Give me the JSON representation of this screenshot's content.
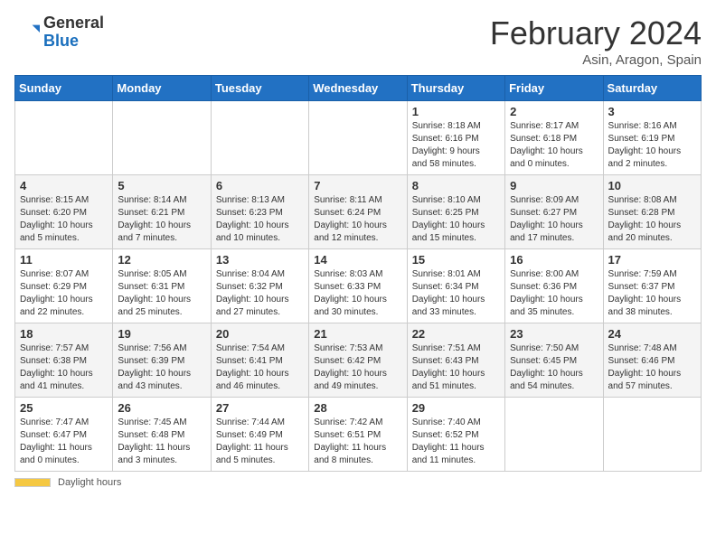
{
  "logo": {
    "general": "General",
    "blue": "Blue"
  },
  "header": {
    "title": "February 2024",
    "subtitle": "Asin, Aragon, Spain"
  },
  "weekdays": [
    "Sunday",
    "Monday",
    "Tuesday",
    "Wednesday",
    "Thursday",
    "Friday",
    "Saturday"
  ],
  "weeks": [
    [
      {
        "day": "",
        "info": ""
      },
      {
        "day": "",
        "info": ""
      },
      {
        "day": "",
        "info": ""
      },
      {
        "day": "",
        "info": ""
      },
      {
        "day": "1",
        "info": "Sunrise: 8:18 AM\nSunset: 6:16 PM\nDaylight: 9 hours\nand 58 minutes."
      },
      {
        "day": "2",
        "info": "Sunrise: 8:17 AM\nSunset: 6:18 PM\nDaylight: 10 hours\nand 0 minutes."
      },
      {
        "day": "3",
        "info": "Sunrise: 8:16 AM\nSunset: 6:19 PM\nDaylight: 10 hours\nand 2 minutes."
      }
    ],
    [
      {
        "day": "4",
        "info": "Sunrise: 8:15 AM\nSunset: 6:20 PM\nDaylight: 10 hours\nand 5 minutes."
      },
      {
        "day": "5",
        "info": "Sunrise: 8:14 AM\nSunset: 6:21 PM\nDaylight: 10 hours\nand 7 minutes."
      },
      {
        "day": "6",
        "info": "Sunrise: 8:13 AM\nSunset: 6:23 PM\nDaylight: 10 hours\nand 10 minutes."
      },
      {
        "day": "7",
        "info": "Sunrise: 8:11 AM\nSunset: 6:24 PM\nDaylight: 10 hours\nand 12 minutes."
      },
      {
        "day": "8",
        "info": "Sunrise: 8:10 AM\nSunset: 6:25 PM\nDaylight: 10 hours\nand 15 minutes."
      },
      {
        "day": "9",
        "info": "Sunrise: 8:09 AM\nSunset: 6:27 PM\nDaylight: 10 hours\nand 17 minutes."
      },
      {
        "day": "10",
        "info": "Sunrise: 8:08 AM\nSunset: 6:28 PM\nDaylight: 10 hours\nand 20 minutes."
      }
    ],
    [
      {
        "day": "11",
        "info": "Sunrise: 8:07 AM\nSunset: 6:29 PM\nDaylight: 10 hours\nand 22 minutes."
      },
      {
        "day": "12",
        "info": "Sunrise: 8:05 AM\nSunset: 6:31 PM\nDaylight: 10 hours\nand 25 minutes."
      },
      {
        "day": "13",
        "info": "Sunrise: 8:04 AM\nSunset: 6:32 PM\nDaylight: 10 hours\nand 27 minutes."
      },
      {
        "day": "14",
        "info": "Sunrise: 8:03 AM\nSunset: 6:33 PM\nDaylight: 10 hours\nand 30 minutes."
      },
      {
        "day": "15",
        "info": "Sunrise: 8:01 AM\nSunset: 6:34 PM\nDaylight: 10 hours\nand 33 minutes."
      },
      {
        "day": "16",
        "info": "Sunrise: 8:00 AM\nSunset: 6:36 PM\nDaylight: 10 hours\nand 35 minutes."
      },
      {
        "day": "17",
        "info": "Sunrise: 7:59 AM\nSunset: 6:37 PM\nDaylight: 10 hours\nand 38 minutes."
      }
    ],
    [
      {
        "day": "18",
        "info": "Sunrise: 7:57 AM\nSunset: 6:38 PM\nDaylight: 10 hours\nand 41 minutes."
      },
      {
        "day": "19",
        "info": "Sunrise: 7:56 AM\nSunset: 6:39 PM\nDaylight: 10 hours\nand 43 minutes."
      },
      {
        "day": "20",
        "info": "Sunrise: 7:54 AM\nSunset: 6:41 PM\nDaylight: 10 hours\nand 46 minutes."
      },
      {
        "day": "21",
        "info": "Sunrise: 7:53 AM\nSunset: 6:42 PM\nDaylight: 10 hours\nand 49 minutes."
      },
      {
        "day": "22",
        "info": "Sunrise: 7:51 AM\nSunset: 6:43 PM\nDaylight: 10 hours\nand 51 minutes."
      },
      {
        "day": "23",
        "info": "Sunrise: 7:50 AM\nSunset: 6:45 PM\nDaylight: 10 hours\nand 54 minutes."
      },
      {
        "day": "24",
        "info": "Sunrise: 7:48 AM\nSunset: 6:46 PM\nDaylight: 10 hours\nand 57 minutes."
      }
    ],
    [
      {
        "day": "25",
        "info": "Sunrise: 7:47 AM\nSunset: 6:47 PM\nDaylight: 11 hours\nand 0 minutes."
      },
      {
        "day": "26",
        "info": "Sunrise: 7:45 AM\nSunset: 6:48 PM\nDaylight: 11 hours\nand 3 minutes."
      },
      {
        "day": "27",
        "info": "Sunrise: 7:44 AM\nSunset: 6:49 PM\nDaylight: 11 hours\nand 5 minutes."
      },
      {
        "day": "28",
        "info": "Sunrise: 7:42 AM\nSunset: 6:51 PM\nDaylight: 11 hours\nand 8 minutes."
      },
      {
        "day": "29",
        "info": "Sunrise: 7:40 AM\nSunset: 6:52 PM\nDaylight: 11 hours\nand 11 minutes."
      },
      {
        "day": "",
        "info": ""
      },
      {
        "day": "",
        "info": ""
      }
    ]
  ],
  "footer": {
    "bar_label": "Daylight hours"
  }
}
